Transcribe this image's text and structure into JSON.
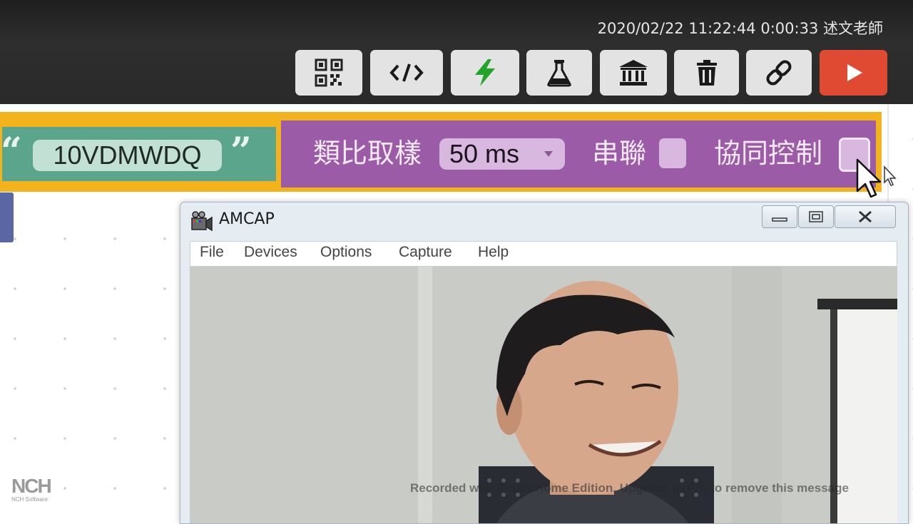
{
  "header": {
    "datetime": "2020/02/22 11:22:44",
    "elapsed": "0:00:33",
    "user": "述文老師"
  },
  "toolbar": {
    "buttons": [
      {
        "icon": "qr-code-icon"
      },
      {
        "icon": "code-icon"
      },
      {
        "icon": "lightning-icon"
      },
      {
        "icon": "flask-icon"
      },
      {
        "icon": "bank-icon"
      },
      {
        "icon": "trash-icon"
      },
      {
        "icon": "link-icon"
      },
      {
        "icon": "play-icon"
      }
    ],
    "accent_color": "#e04a33",
    "lightning_color": "#22a32a"
  },
  "blocks": {
    "text_block": {
      "open_quote": "“",
      "value": "10VDMWDQ",
      "close_quote": "”",
      "color": "#5ba58c"
    },
    "config_block": {
      "sampling_label": "類比取樣",
      "sampling_value": "50 ms",
      "serial_label": "串聯",
      "collab_label": "協同控制",
      "color": "#9b5ba7",
      "outline_color": "#f3b31d"
    }
  },
  "amcap": {
    "title": "AMCAP",
    "menu": [
      "File",
      "Devices",
      "Options",
      "Capture",
      "Help"
    ]
  },
  "overlay": {
    "watermark": "Recorded with Debut Home Edition. Upgrade to Pro to remove this message",
    "nch_logo": "NCH",
    "nch_sub": "NCH Software"
  }
}
